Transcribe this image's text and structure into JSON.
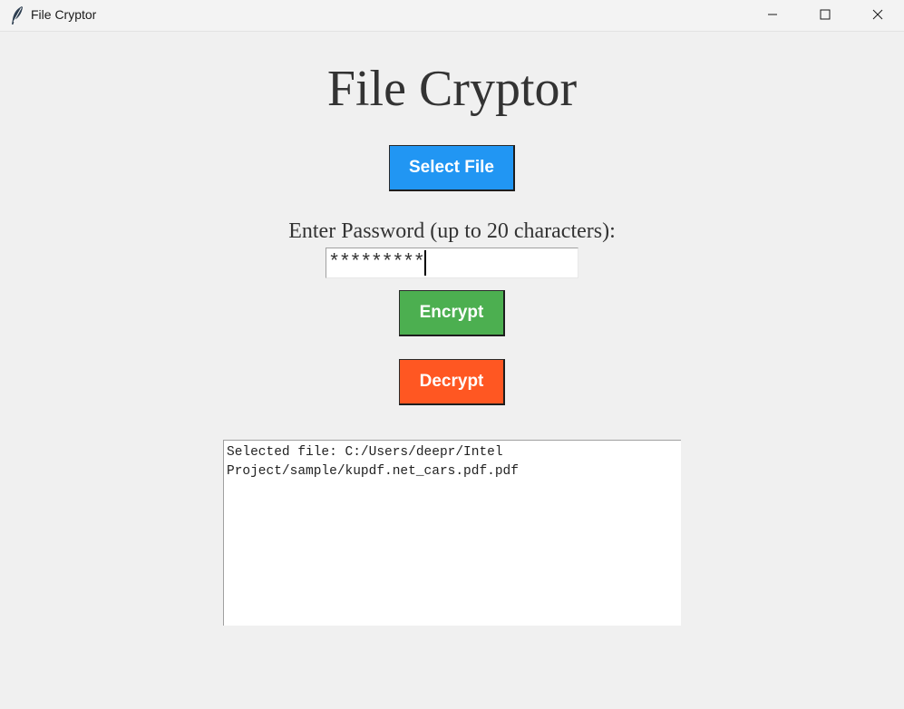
{
  "window": {
    "title": "File Cryptor",
    "icon": "feather-icon",
    "controls": [
      "minimize-icon",
      "maximize-icon",
      "close-icon"
    ]
  },
  "app": {
    "heading": "File Cryptor"
  },
  "buttons": {
    "select_file": "Select File",
    "encrypt": "Encrypt",
    "decrypt": "Decrypt"
  },
  "password": {
    "label": "Enter Password (up to 20 characters):",
    "masked_value": "*********"
  },
  "output": {
    "text": "Selected file: C:/Users/deepr/Intel Project/sample/kupdf.net_cars.pdf.pdf"
  },
  "colors": {
    "select_button": "#2196f3",
    "encrypt_button": "#4caf50",
    "decrypt_button": "#ff5722",
    "background": "#f0f0f0"
  }
}
